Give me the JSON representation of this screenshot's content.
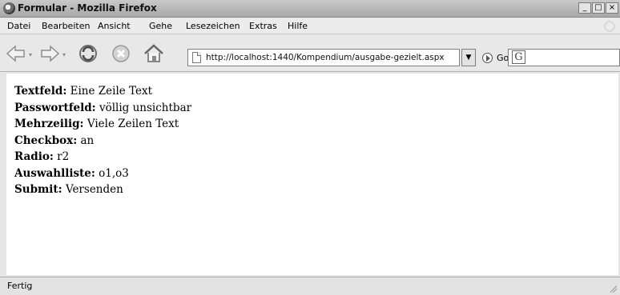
{
  "window": {
    "title": "Formular - Mozilla Firefox",
    "controls": {
      "minimize": "_",
      "maximize": "□",
      "close": "×"
    }
  },
  "menu": {
    "items": [
      {
        "label": "Datei"
      },
      {
        "label": "Bearbeiten"
      },
      {
        "label": "Ansicht"
      },
      {
        "label": "Gehe"
      },
      {
        "label": "Lesezeichen"
      },
      {
        "label": "Extras"
      },
      {
        "label": "Hilfe"
      }
    ]
  },
  "nav": {
    "address": "http://localhost:1440/Kompendium/ausgabe-gezielt.aspx",
    "go_label": "Go",
    "dropdown_arrow": "▼"
  },
  "content": {
    "lines": [
      {
        "label": "Textfeld:",
        "value": "Eine Zeile Text"
      },
      {
        "label": "Passwortfeld:",
        "value": "völlig unsichtbar"
      },
      {
        "label": "Mehrzeilig:",
        "value": "Viele Zeilen Text"
      },
      {
        "label": "Checkbox:",
        "value": "an"
      },
      {
        "label": "Radio:",
        "value": "r2"
      },
      {
        "label": "Auswahlliste:",
        "value": "o1,o3"
      },
      {
        "label": "Submit:",
        "value": "Versenden"
      }
    ]
  },
  "status": {
    "text": "Fertig"
  }
}
